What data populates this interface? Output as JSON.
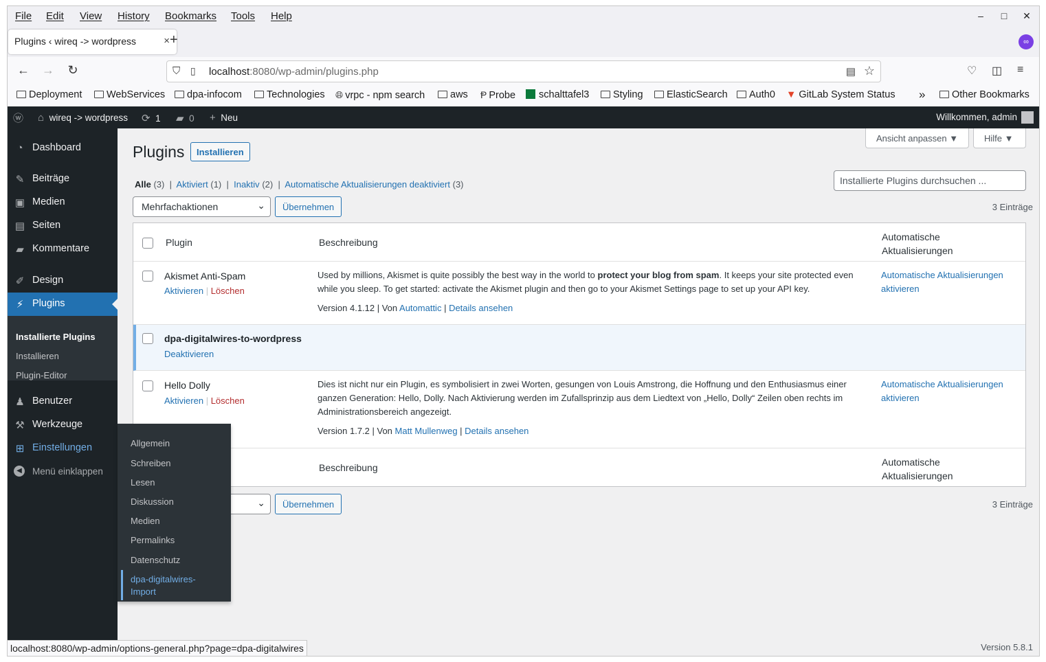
{
  "menubar": {
    "items": [
      "File",
      "Edit",
      "View",
      "History",
      "Bookmarks",
      "Tools",
      "Help"
    ]
  },
  "window_controls": {
    "minimize": "–",
    "maximize": "□",
    "close": "✕"
  },
  "tab": {
    "title": "Plugins ‹ wireq -> wordpress",
    "close": "×",
    "new": "+"
  },
  "url": {
    "host": "localhost",
    "rest": ":8080/wp-admin/plugins.php"
  },
  "bookmarks": [
    "Deployment",
    "WebServices",
    "dpa-infocom",
    "Technologies",
    "vrpc - npm search",
    "aws",
    "Probe",
    "schalttafel3",
    "Styling",
    "ElasticSearch",
    "Auth0",
    "GitLab System Status",
    "Other Bookmarks"
  ],
  "bookmarks_overflow": "»",
  "adminbar": {
    "site": "wireq -> wordpress",
    "updates": "1",
    "comments": "0",
    "new": "Neu",
    "welcome": "Willkommen, admin"
  },
  "sidebar": {
    "items": [
      "Dashboard",
      "Beiträge",
      "Medien",
      "Seiten",
      "Kommentare",
      "Design",
      "Plugins",
      "Benutzer",
      "Werkzeuge",
      "Einstellungen"
    ],
    "submenu": [
      "Installierte Plugins",
      "Installieren",
      "Plugin-Editor"
    ],
    "collapse": "Menü einklappen"
  },
  "flyout": [
    "Allgemein",
    "Schreiben",
    "Lesen",
    "Diskussion",
    "Medien",
    "Permalinks",
    "Datenschutz",
    "dpa-digitalwires-Import"
  ],
  "screen": {
    "options": "Ansicht anpassen ▼",
    "help": "Hilfe ▼"
  },
  "page": {
    "title": "Plugins",
    "add_new": "Installieren",
    "filters": {
      "all": "Alle",
      "all_count": "(3)",
      "active": "Aktiviert",
      "active_count": "(1)",
      "inactive": "Inaktiv",
      "inactive_count": "(2)",
      "auto_off": "Automatische Aktualisierungen deaktiviert",
      "auto_off_count": "(3)",
      "sep": "|"
    },
    "search_placeholder": "Installierte Plugins durchsuchen ...",
    "bulk": "Mehrfachaktionen",
    "apply": "Übernehmen",
    "count": "3 Einträge"
  },
  "table": {
    "headers": {
      "plugin": "Plugin",
      "desc": "Beschreibung",
      "auto": "Automatische Aktualisierungen"
    },
    "rows": [
      {
        "name": "Akismet Anti-Spam",
        "activate": "Aktivieren",
        "delete": "Löschen",
        "desc_pre": "Used by millions, Akismet is quite possibly the best way in the world to ",
        "desc_bold": "protect your blog from spam",
        "desc_post": ". It keeps your site protected even while you sleep. To get started: activate the Akismet plugin and then go to your Akismet Settings page to set up your API key.",
        "version": "Version 4.1.12 | Von ",
        "author": "Automattic",
        "details": "Details ansehen",
        "auto": "Automatische Aktualisierungen aktivieren"
      },
      {
        "name": "dpa-digitalwires-to-wordpress",
        "deactivate": "Deaktivieren"
      },
      {
        "name": "Hello Dolly",
        "activate": "Aktivieren",
        "delete": "Löschen",
        "desc": "Dies ist nicht nur ein Plugin, es symbolisiert in zwei Worten, gesungen von Louis Amstrong, die Hoffnung und den Enthusiasmus einer ganzen Generation: Hello, Dolly. Nach Aktivierung werden im Zufallsprinzip aus dem Liedtext von „Hello, Dolly“ Zeilen oben rechts im Administrationsbereich angezeigt.",
        "version": "Version 1.7.2 | Von ",
        "author": "Matt Mullenweg",
        "details": "Details ansehen",
        "auto": "Automatische Aktualisierungen aktivieren"
      }
    ]
  },
  "footer": {
    "version": "Version 5.8.1"
  },
  "statusbar": "localhost:8080/wp-admin/options-general.php?page=dpa-digitalwires"
}
